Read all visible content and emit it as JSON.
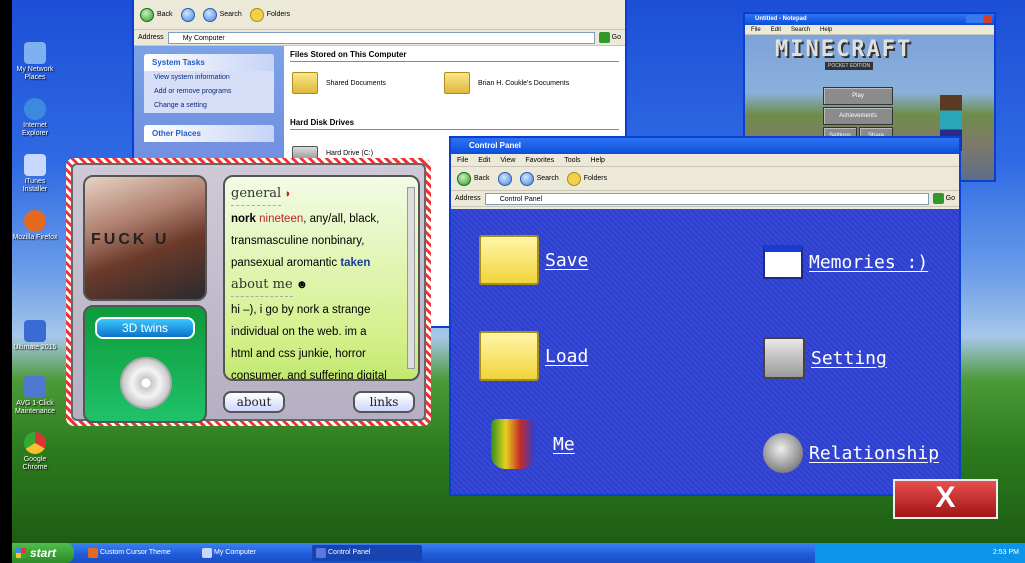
{
  "desktop_icons": [
    {
      "label": "My Network Places"
    },
    {
      "label": "Internet Explorer"
    },
    {
      "label": "iTunes Installer"
    },
    {
      "label": "Mozilla Firefox"
    },
    {
      "label": "Ultimate 2015"
    },
    {
      "label": "AVG 1-Click Maintenance"
    },
    {
      "label": "Google Chrome"
    }
  ],
  "my_computer": {
    "toolbar": {
      "back": "Back",
      "search": "Search",
      "folders": "Folders"
    },
    "address_label": "Address",
    "address": "My Computer",
    "go": "Go",
    "system_tasks": {
      "title": "System Tasks",
      "items": [
        "View system information",
        "Add or remove programs",
        "Change a setting"
      ]
    },
    "other_places": "Other Places",
    "files_header": "Files Stored on This Computer",
    "shared": "Shared Documents",
    "user_docs": "Brian H. Coukle's Documents",
    "hdd_header": "Hard Disk Drives",
    "hdd": "Hard Drive (C:)"
  },
  "notepad": {
    "title": "Untitled - Notepad",
    "menu": [
      "File",
      "Edit",
      "Search",
      "Help"
    ],
    "game": {
      "logo": "MINECRAFT",
      "edition": "POCKET EDITION",
      "play": "Play",
      "achievements": "Achievements",
      "settings": "Settings",
      "share": "Share"
    }
  },
  "control_panel": {
    "title": "Control Panel",
    "menu": [
      "File",
      "Edit",
      "View",
      "Favorites",
      "Tools",
      "Help"
    ],
    "toolbar": {
      "back": "Back",
      "search": "Search",
      "folders": "Folders"
    },
    "address_label": "Address",
    "address": "Control Panel",
    "go": "Go",
    "items": {
      "save": "Save",
      "load": "Load",
      "me": "Me",
      "memories": "Memories :)",
      "setting": "Setting",
      "relationship": "Relationship"
    }
  },
  "profile": {
    "photo_text": "FUCK U",
    "player_label": "3D twins",
    "heading_general": "general",
    "line1_a": "nork ",
    "line1_b": "nineteen",
    "line1_c": ", any/all, black,",
    "line2": "transmasculine nonbinary,",
    "line3_a": "pansexual aromantic ",
    "line3_b": "taken",
    "heading_about": "about me",
    "about_1": "hi –), i go by nork a strange",
    "about_2": "individual on the web. im a",
    "about_3": "html and css junkie, horror",
    "about_4": "consumer, and suffering digital",
    "btn_about": "about",
    "btn_links": "links"
  },
  "close_button": "X",
  "taskbar": {
    "start": "start",
    "items": [
      "Custom Cursor Theme",
      "My Computer",
      "Control Panel"
    ],
    "clock": "2:53 PM"
  }
}
